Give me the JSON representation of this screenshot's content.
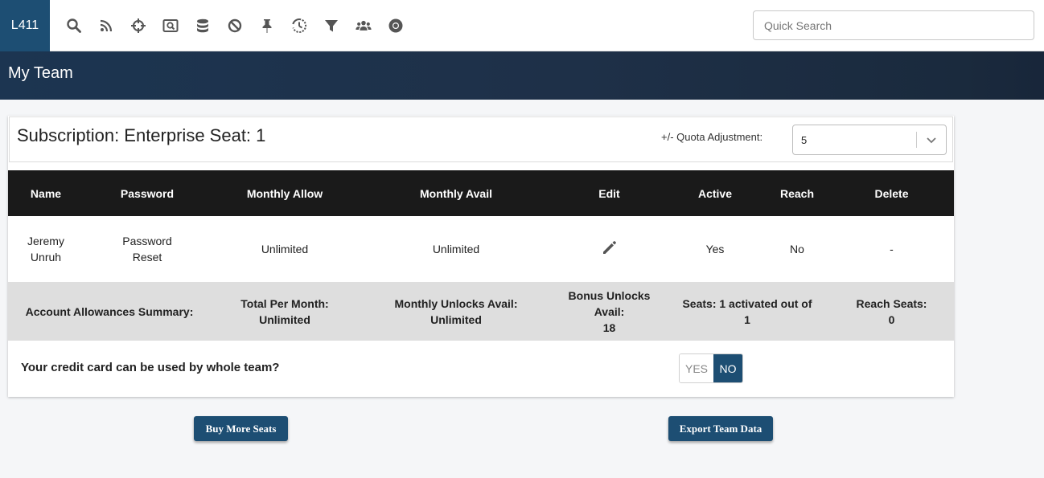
{
  "app": {
    "logo_text": "L411",
    "search_placeholder": "Quick Search",
    "nav_icons": [
      "search-icon",
      "rss-icon",
      "crosshair-icon",
      "search-box-icon",
      "database-icon",
      "ban-icon",
      "pin-icon",
      "history-icon",
      "filter-icon",
      "team-icon",
      "chrome-icon"
    ]
  },
  "page": {
    "title": "My Team"
  },
  "subscription": {
    "title": "Subscription: Enterprise Seat: 1",
    "quota_label": "+/- Quota Adjustment:",
    "quota_value": "5"
  },
  "table": {
    "headers": [
      "Name",
      "Password",
      "Monthly Allow",
      "Monthly Avail",
      "Edit",
      "Active",
      "Reach",
      "Delete"
    ],
    "rows": [
      {
        "name_first": "Jeremy",
        "name_last": "Unruh",
        "password_1": "Password",
        "password_2": "Reset",
        "monthly_allow": "Unlimited",
        "monthly_avail": "Unlimited",
        "edit_icon": "pencil-icon",
        "active": "Yes",
        "reach": "No",
        "delete": "-"
      }
    ]
  },
  "summary": {
    "label": "Account Allowances Summary:",
    "total_label": "Total Per Month:",
    "total_value": "Unlimited",
    "unlocks_label": "Monthly Unlocks Avail:",
    "unlocks_value": "Unlimited",
    "bonus_label": "Bonus Unlocks Avail:",
    "bonus_value": "18",
    "seats_label": "Seats: 1 activated out of",
    "seats_value": "1",
    "reach_label": "Reach Seats:",
    "reach_value": "0"
  },
  "credit": {
    "label": "Your credit card can be used by whole team?",
    "yes": "YES",
    "no": "NO",
    "selected": "NO"
  },
  "buttons": {
    "buy": "Buy More Seats",
    "export": "Export Team Data"
  },
  "colors": {
    "brand": "#1d4e73",
    "header_dark": "#1a1a1a",
    "summary_bg": "#dedede"
  }
}
